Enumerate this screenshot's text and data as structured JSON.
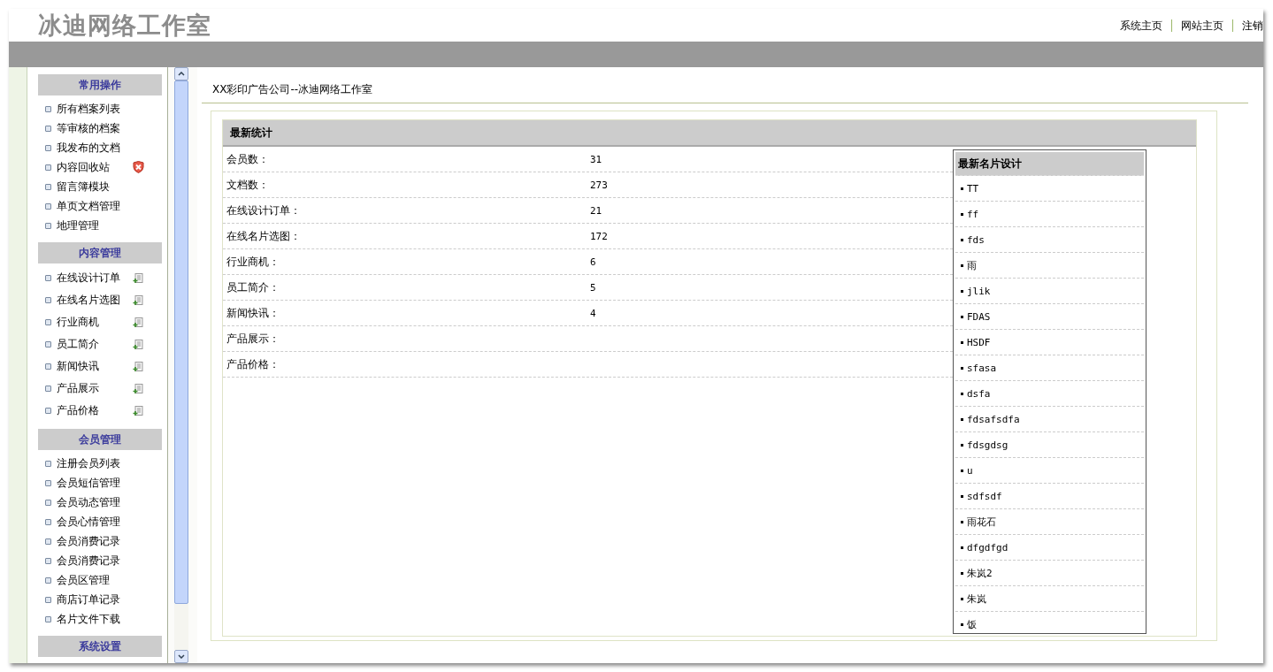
{
  "logo": "冰迪网络工作室",
  "top_links": [
    "系统主页",
    "网站主页",
    "注销"
  ],
  "sidebar": [
    {
      "title": "常用操作",
      "items": [
        {
          "label": "所有档案列表",
          "kind": "plain"
        },
        {
          "label": "等审核的档案",
          "kind": "plain"
        },
        {
          "label": "我发布的文档",
          "kind": "plain"
        },
        {
          "label": "内容回收站",
          "kind": "recycle"
        },
        {
          "label": "留言簿模块",
          "kind": "plain"
        },
        {
          "label": "单页文档管理",
          "kind": "plain"
        },
        {
          "label": "地理管理",
          "kind": "plain"
        }
      ]
    },
    {
      "title": "内容管理",
      "items": [
        {
          "label": "在线设计订单",
          "kind": "add"
        },
        {
          "label": "在线名片选图",
          "kind": "add"
        },
        {
          "label": "行业商机",
          "kind": "add"
        },
        {
          "label": "员工简介",
          "kind": "add"
        },
        {
          "label": "新闻快讯",
          "kind": "add"
        },
        {
          "label": "产品展示",
          "kind": "add"
        },
        {
          "label": "产品价格",
          "kind": "add"
        }
      ]
    },
    {
      "title": "会员管理",
      "items": [
        {
          "label": "注册会员列表",
          "kind": "plain"
        },
        {
          "label": "会员短信管理",
          "kind": "plain"
        },
        {
          "label": "会员动态管理",
          "kind": "plain"
        },
        {
          "label": "会员心情管理",
          "kind": "plain"
        },
        {
          "label": "会员消费记录",
          "kind": "plain"
        },
        {
          "label": "会员消费记录",
          "kind": "plain"
        },
        {
          "label": "会员区管理",
          "kind": "plain"
        },
        {
          "label": "商店订单记录",
          "kind": "plain"
        },
        {
          "label": "名片文件下载",
          "kind": "plain"
        }
      ]
    },
    {
      "title": "系统设置"
    }
  ],
  "breadcrumb": "XX彩印广告公司--冰迪网络工作室",
  "stats": {
    "title": "最新统计",
    "rows": [
      {
        "label": "会员数：",
        "value": "31"
      },
      {
        "label": "文档数：",
        "value": "273"
      },
      {
        "label": "在线设计订单：",
        "value": "21"
      },
      {
        "label": "在线名片选图：",
        "value": "172"
      },
      {
        "label": "行业商机：",
        "value": "6"
      },
      {
        "label": "员工简介：",
        "value": "5"
      },
      {
        "label": "新闻快讯：",
        "value": "4"
      },
      {
        "label": "产品展示："
      },
      {
        "label": "产品价格："
      }
    ]
  },
  "latest_designs": {
    "title": "最新名片设计",
    "items": [
      "TT",
      "ff",
      "fds",
      "雨",
      "jlik",
      "FDAS",
      "HSDF",
      "sfasa",
      "dsfa",
      "fdsafsdfa",
      "fdsgdsg",
      "u",
      "sdfsdf",
      "雨花石",
      "dfgdfgd",
      "朱岚2",
      "朱岚",
      "饭"
    ]
  }
}
